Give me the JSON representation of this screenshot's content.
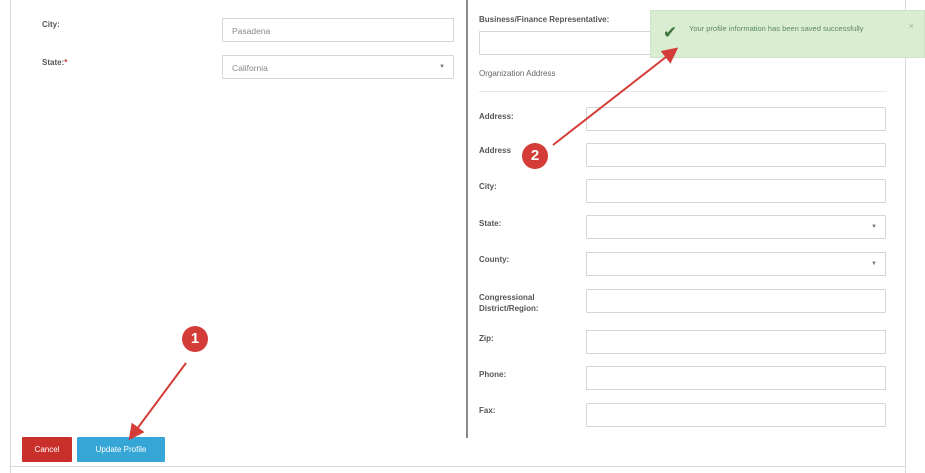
{
  "left": {
    "city_label": "City:",
    "city_value": "Pasadena",
    "state_label": "State:",
    "state_required": "*",
    "state_value": "California"
  },
  "right": {
    "business_rep_label": "Business/Finance Representative:",
    "org_address_title": "Organization Address",
    "address1_label": "Address:",
    "address2_label": "Address",
    "city_label": "City:",
    "state_label": "State:",
    "county_label": "County:",
    "congressional_label": "Congressional District/Region:",
    "zip_label": "Zip:",
    "phone_label": "Phone:",
    "fax_label": "Fax:"
  },
  "buttons": {
    "cancel": "Cancel",
    "update": "Update Profile"
  },
  "toast": {
    "message": "Your profile information has been saved successfully",
    "close": "×",
    "check": "✔"
  },
  "annotations": {
    "step1": "1",
    "step2": "2",
    "color": "#d43c37"
  },
  "colors": {
    "cancel_bg": "#c9302c",
    "update_bg": "#36a6d6",
    "toast_bg": "#d9edd1"
  }
}
